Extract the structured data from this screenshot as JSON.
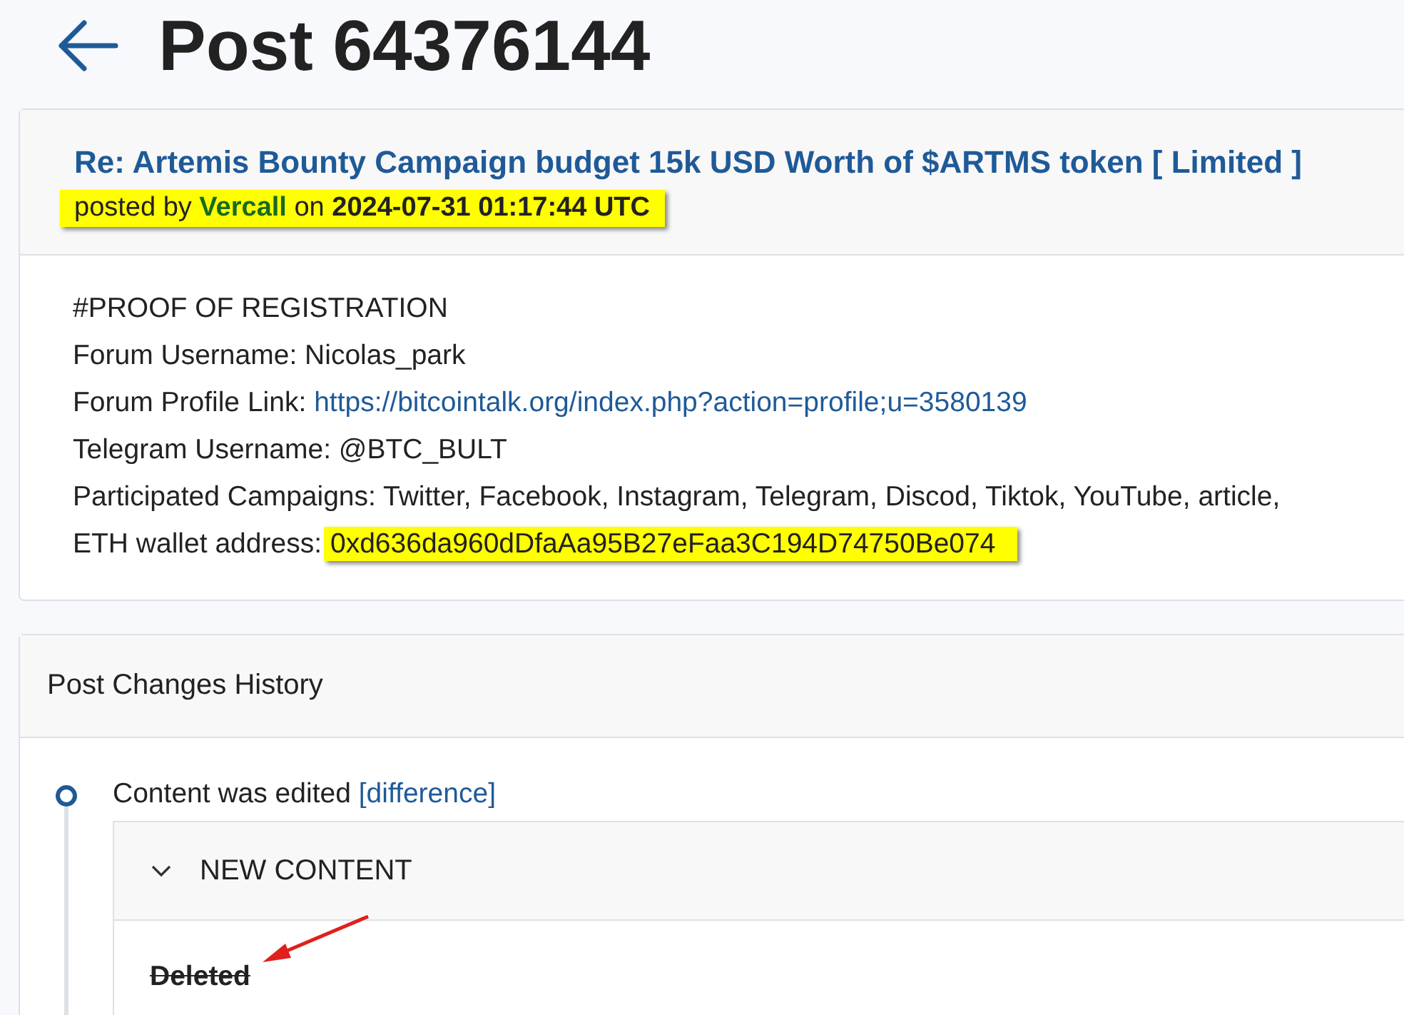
{
  "page": {
    "title": "Post 64376144"
  },
  "post": {
    "topic_link": "Re: Artemis Bounty Campaign budget 15k USD Worth of $ARTMS token [ Limited ]",
    "byline": {
      "prefix": "posted by",
      "author": "Vercall",
      "joiner": "on",
      "date": "2024-07-31 01:17:44 UTC",
      "highlighted": true
    },
    "lines": [
      {
        "kind": "text",
        "label": "#PROOF OF REGISTRATION"
      },
      {
        "kind": "text",
        "label": "Forum Username: Nicolas_park"
      },
      {
        "kind": "link",
        "label": "Forum Profile Link:",
        "value": "https://bitcointalk.org/index.php?action=profile;u=3580139"
      },
      {
        "kind": "text",
        "label": "Telegram Username: @BTC_BULT"
      },
      {
        "kind": "text",
        "label": "Participated Campaigns: Twitter, Facebook, Instagram, Telegram, Discod, Tiktok, YouTube, article,"
      },
      {
        "kind": "highlight",
        "label": "ETH wallet address:",
        "value": "0xd636da960dDfaAa95B27eFaa3C194D74750Be074"
      }
    ]
  },
  "history": {
    "title": "Post Changes History",
    "events": [
      {
        "text": "Content was edited",
        "link": "[difference]",
        "section": {
          "title": "NEW CONTENT",
          "expanded": true,
          "content": "Deleted",
          "strikethrough": true
        }
      }
    ]
  }
}
